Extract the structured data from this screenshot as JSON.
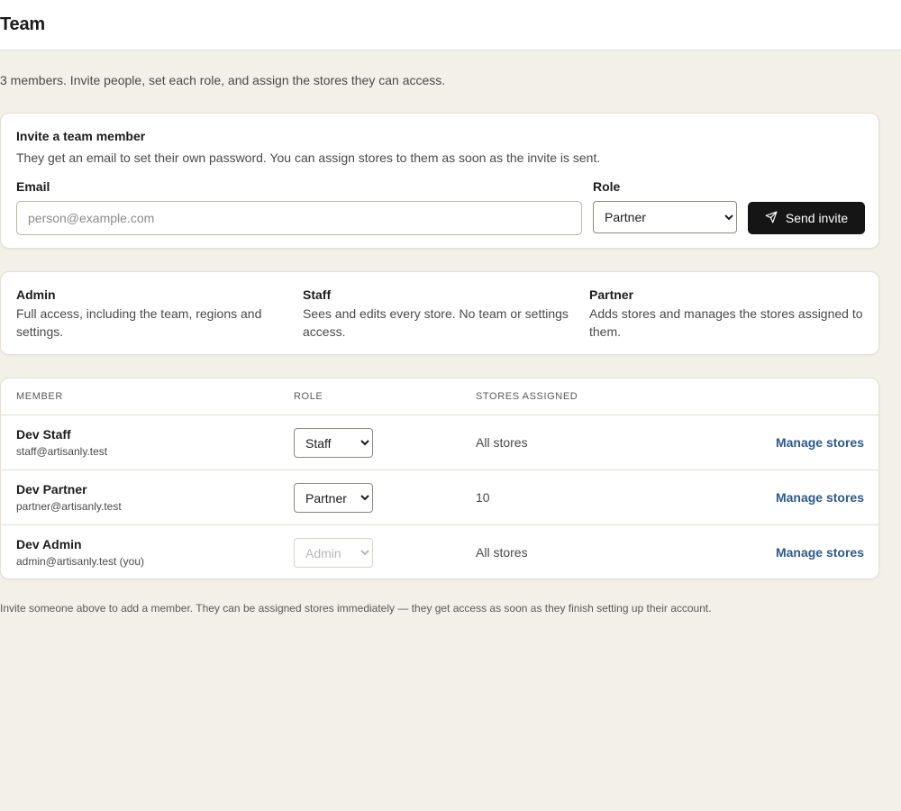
{
  "header": {
    "title": "Team"
  },
  "subtitle": "3 members. Invite people, set each role, and assign the stores they can access.",
  "invite": {
    "title": "Invite a team member",
    "description": "They get an email to set their own password. You can assign stores to them as soon as the invite is sent.",
    "email_label": "Email",
    "email_placeholder": "person@example.com",
    "email_value": "",
    "role_label": "Role",
    "role_selected": "Partner",
    "send_label": "Send invite",
    "send_icon": "send-icon"
  },
  "roles": [
    {
      "name": "Admin",
      "description": "Full access, including the team, regions and settings."
    },
    {
      "name": "Staff",
      "description": "Sees and edits every store. No team or settings access."
    },
    {
      "name": "Partner",
      "description": "Adds stores and manages the stores assigned to them."
    }
  ],
  "table": {
    "headers": {
      "member": "MEMBER",
      "role": "ROLE",
      "stores": "STORES ASSIGNED"
    },
    "rows": [
      {
        "name": "Dev Staff",
        "email": "staff@artisanly.test",
        "role": "Staff",
        "stores": "All stores",
        "action": "Manage stores"
      },
      {
        "name": "Dev Partner",
        "email": "partner@artisanly.test",
        "role": "Partner",
        "stores": "10",
        "action": "Manage stores"
      },
      {
        "name": "Dev Admin",
        "email": "admin@artisanly.test (you)",
        "role": "Admin",
        "stores": "All stores",
        "action": "Manage stores"
      }
    ]
  },
  "footnote": "Invite someone above to add a member. They can be assigned stores immediately — they get access as soon as they finish setting up their account.",
  "colors": {
    "accent_button": "#151515",
    "link": "#2f5a8a",
    "page_bg": "#f3f0e7"
  }
}
